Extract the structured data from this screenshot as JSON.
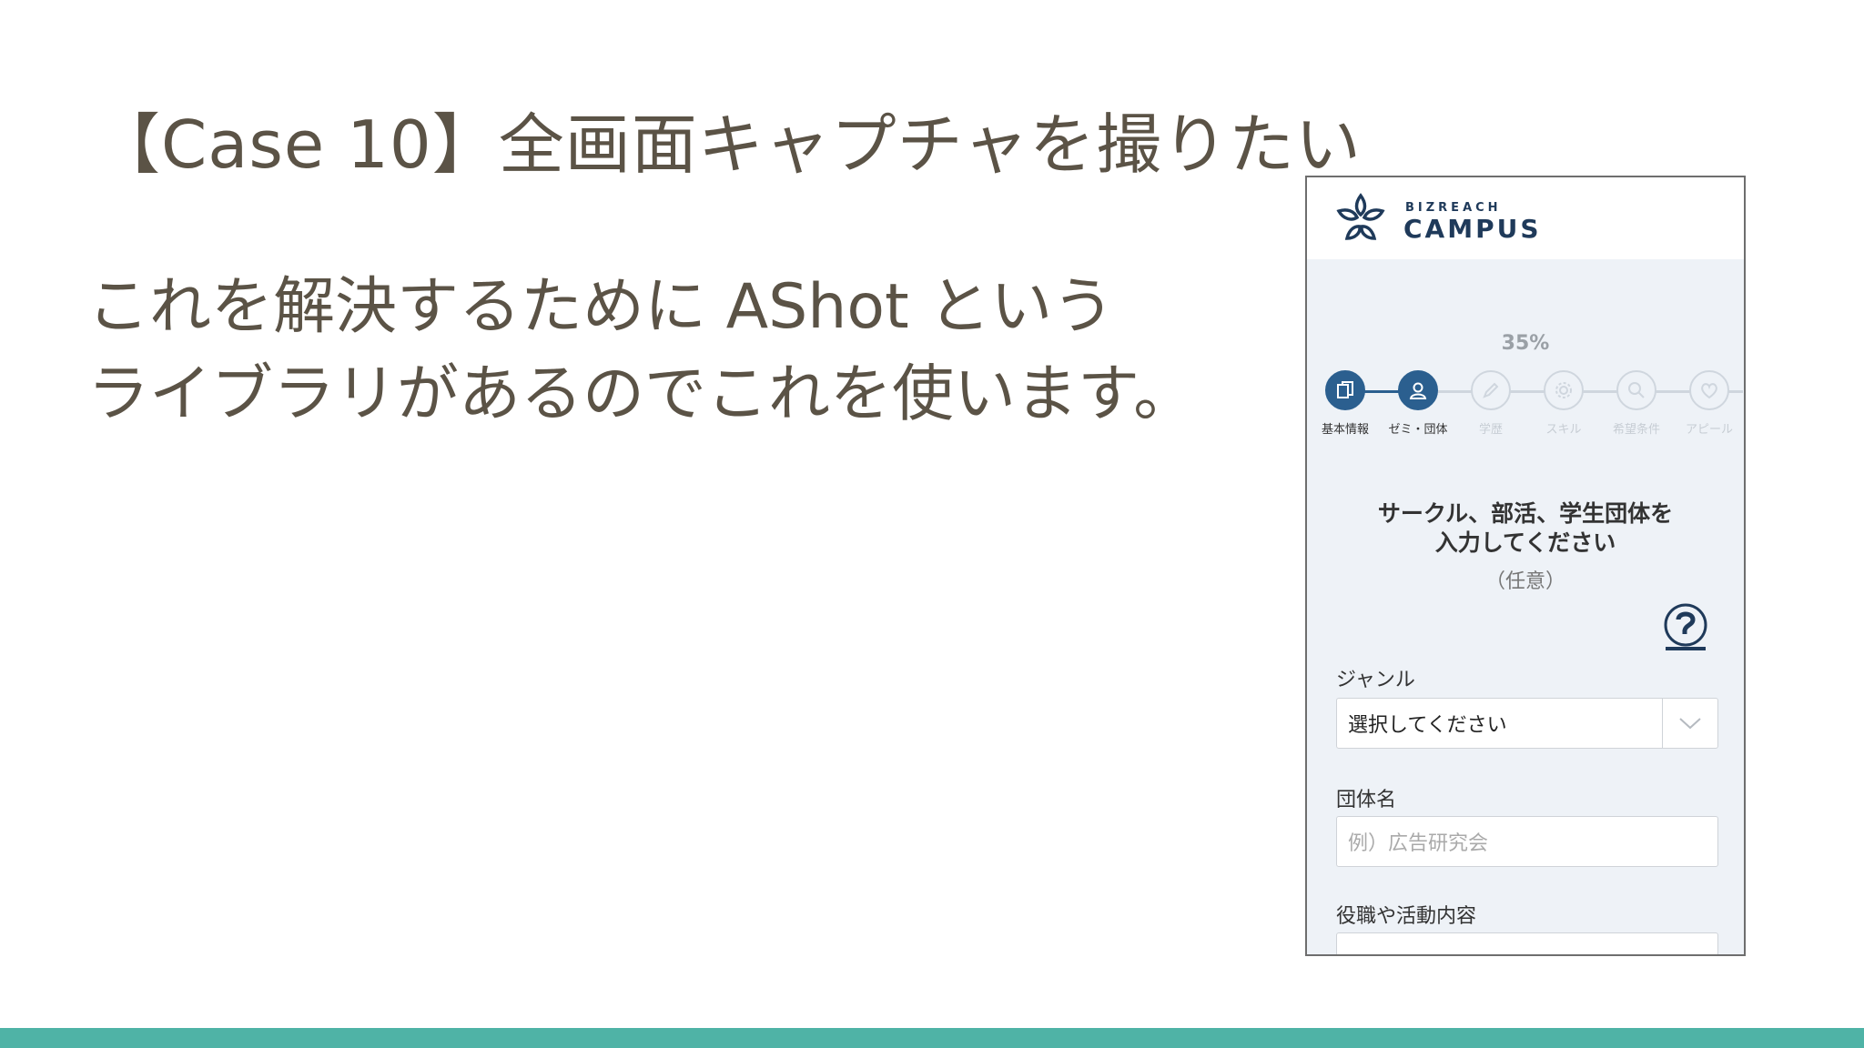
{
  "slide": {
    "title": "【Case 10】全画面キャプチャを撮りたい",
    "body_lines": [
      "これを解決するために AShot という",
      "ライブラリがあるのでこれを使います。"
    ]
  },
  "colors": {
    "text": "#5b5346",
    "accent_bar": "#4fb3a6",
    "brand_navy": "#1f3a5a",
    "step_active": "#2b5f8f"
  },
  "phone": {
    "brand_small": "BIZREACH",
    "brand_big": "CAMPUS",
    "progress": {
      "percent_text": "35%",
      "value": 35
    },
    "steps": [
      {
        "label": "基本情報",
        "icon": "document-icon",
        "done": true
      },
      {
        "label": "ゼミ・団体",
        "icon": "person-icon",
        "done": true
      },
      {
        "label": "学歴",
        "icon": "pencil-icon",
        "done": false
      },
      {
        "label": "スキル",
        "icon": "gear-icon",
        "done": false
      },
      {
        "label": "希望条件",
        "icon": "search-icon",
        "done": false
      },
      {
        "label": "アピール",
        "icon": "heart-icon",
        "done": false
      }
    ],
    "form": {
      "heading_line1": "サークル、部活、学生団体を",
      "heading_line2": "入力してください",
      "optional": "（任意）",
      "genre_label": "ジャンル",
      "genre_value": "選択してください",
      "org_label": "団体名",
      "org_placeholder": "例）広告研究会",
      "role_label": "役職や活動内容"
    }
  }
}
